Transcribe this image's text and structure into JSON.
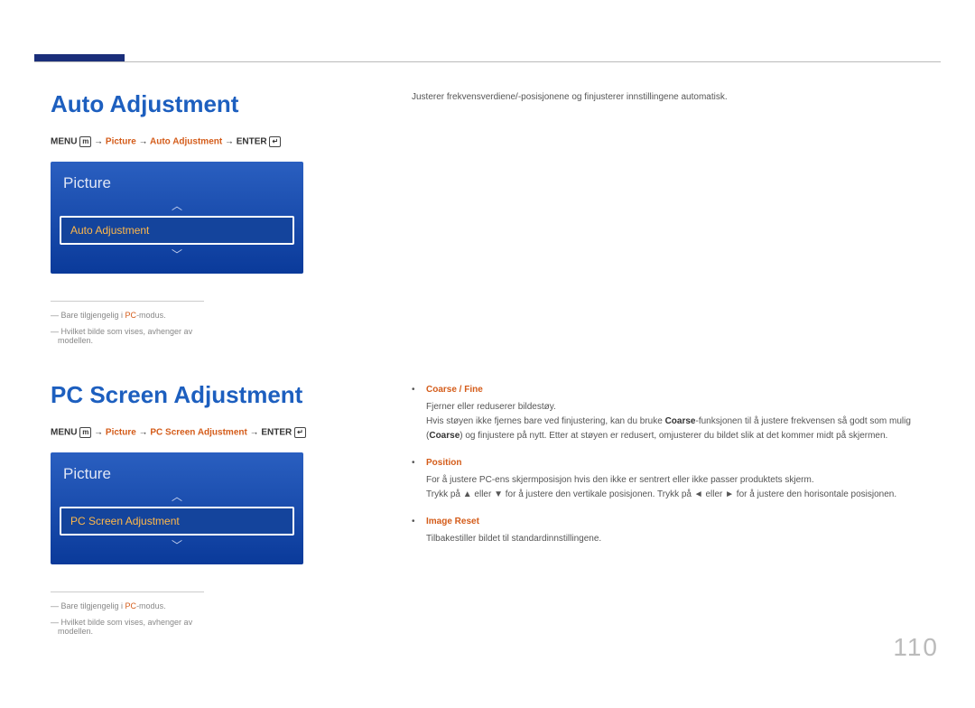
{
  "page_number": "110",
  "section1": {
    "heading": "Auto Adjustment",
    "path": {
      "prefix": "MENU ",
      "menu_icon": "m",
      "arrow": " → ",
      "p1": "Picture",
      "p2": "Auto Adjustment",
      "suffix": "ENTER ",
      "enter_icon": "↵"
    },
    "menu": {
      "title": "Picture",
      "item": "Auto Adjustment",
      "up": "︿",
      "down": "﹀"
    },
    "footnotes": {
      "f1_pre": "― Bare tilgjengelig i ",
      "f1_hl": "PC",
      "f1_post": "-modus.",
      "f2": "― Hvilket bilde som vises, avhenger av modellen."
    },
    "description": "Justerer frekvensverdiene/-posisjonene og finjusterer innstillingene automatisk."
  },
  "section2": {
    "heading": "PC Screen Adjustment",
    "path": {
      "prefix": "MENU ",
      "menu_icon": "m",
      "arrow": " → ",
      "p1": "Picture",
      "p2": "PC Screen Adjustment",
      "suffix": "ENTER ",
      "enter_icon": "↵"
    },
    "menu": {
      "title": "Picture",
      "item": "PC Screen Adjustment",
      "up": "︿",
      "down": "﹀"
    },
    "footnotes": {
      "f1_pre": "― Bare tilgjengelig i ",
      "f1_hl": "PC",
      "f1_post": "-modus.",
      "f2": "― Hvilket bilde som vises, avhenger av modellen."
    },
    "bullets": [
      {
        "title": "Coarse / Fine",
        "body_pre": "Fjerner eller reduserer bildestøy.\nHvis støyen ikke fjernes bare ved finjustering, kan du bruke ",
        "bold1": "Coarse",
        "body_mid": "-funksjonen til å justere frekvensen så godt som mulig (",
        "bold2": "Coarse",
        "body_post": ") og finjustere på nytt. Etter at støyen er redusert, omjusterer du bildet slik at det kommer midt på skjermen."
      },
      {
        "title": "Position",
        "body_pre": "For å justere PC-ens skjermposisjon hvis den ikke er sentrert eller ikke passer produktets skjerm.\nTrykk på ▲ eller ▼ for å justere den vertikale posisjonen. Trykk på ◄ eller ► for å justere den horisontale posisjonen.",
        "bold1": "",
        "body_mid": "",
        "bold2": "",
        "body_post": ""
      },
      {
        "title": "Image Reset",
        "body_pre": "Tilbakestiller bildet til standardinnstillingene.",
        "bold1": "",
        "body_mid": "",
        "bold2": "",
        "body_post": ""
      }
    ]
  }
}
